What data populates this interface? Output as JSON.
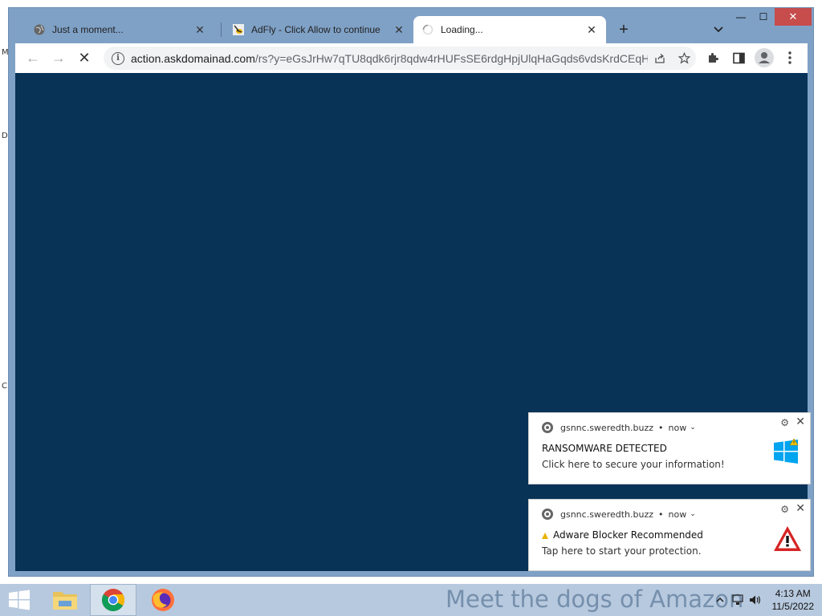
{
  "desktop": {
    "edge_letters": [
      "M",
      "D",
      "C"
    ]
  },
  "window": {
    "controls": {
      "minimize": "—",
      "maximize": "☐",
      "close": "✕"
    }
  },
  "tabs": [
    {
      "label": "Just a moment...",
      "favicon": "globe-icon",
      "active": false
    },
    {
      "label": "AdFly - Click Allow to continue",
      "favicon": "adfly-bee-icon",
      "active": false
    },
    {
      "label": "Loading...",
      "favicon": "loading-spinner-icon",
      "active": true
    }
  ],
  "toolbar": {
    "back": "←",
    "forward": "→",
    "stop": "✕",
    "url_domain": "action.askdomainad.com",
    "url_path": "/rs?y=eGsJrHw7qTU8qdk6rjr8qdw4rHUFsSE6rdgHpjUlqHaGqds6vdsKrdCEqH..."
  },
  "page": {
    "background": "#083357"
  },
  "notifications": [
    {
      "source": "gsnnc.sweredth.buzz",
      "time": "now",
      "title": "RANSOMWARE DETECTED",
      "body": "Click here to secure your information!",
      "icon": "windows-logo-warning-icon"
    },
    {
      "source": "gsnnc.sweredth.buzz",
      "time": "now",
      "title": "Adware Blocker Recommended",
      "body": "Tap here to start your protection.",
      "icon": "red-warning-triangle-icon"
    }
  ],
  "taskbar": {
    "ticker": "Meet the dogs of Amazon",
    "clock_time": "4:13 AM",
    "clock_date": "11/5/2022"
  }
}
